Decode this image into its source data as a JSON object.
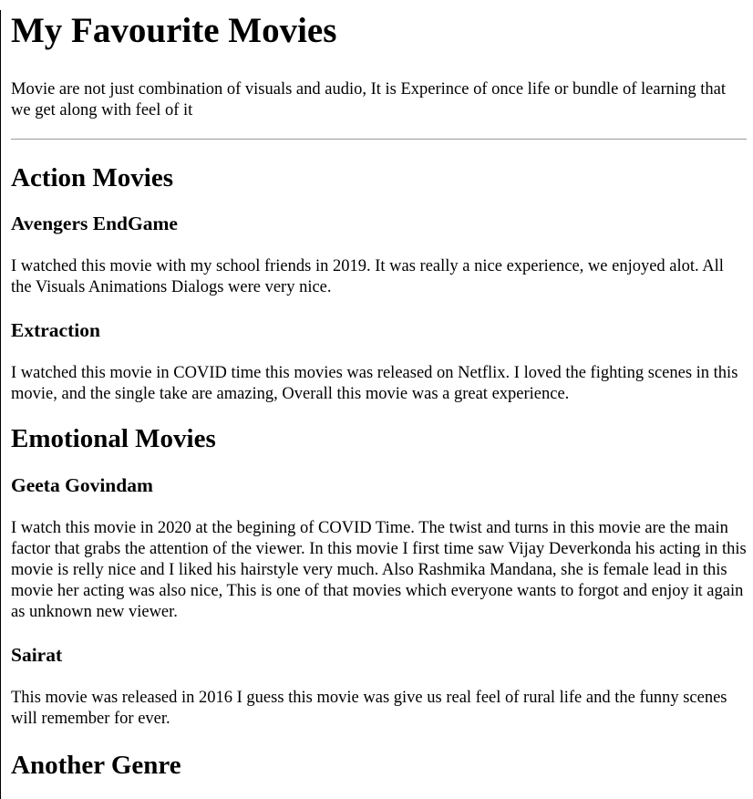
{
  "page": {
    "title": "My Favourite Movies",
    "intro": "Movie are not just combination of visuals and audio, It is Experince of once life or bundle of learning that we get along with feel of it"
  },
  "sections": [
    {
      "heading": "Action Movies",
      "movies": [
        {
          "title": "Avengers EndGame",
          "text": "I watched this movie with my school friends in 2019. It was really a nice experience, we enjoyed alot. All the Visuals Animations Dialogs were very nice."
        },
        {
          "title": "Extraction",
          "text": "I watched this movie in COVID time this movies was released on Netflix. I loved the fighting scenes in this movie, and the single take are amazing, Overall this movie was a great experience."
        }
      ]
    },
    {
      "heading": "Emotional Movies",
      "movies": [
        {
          "title": "Geeta Govindam",
          "text": "I watch this movie in 2020 at the begining of COVID Time. The twist and turns in this movie are the main factor that grabs the attention of the viewer. In this movie I first time saw Vijay Deverkonda his acting in this movie is relly nice and I liked his hairstyle very much. Also Rashmika Mandana, she is female lead in this movie her acting was also nice, This is one of that movies which everyone wants to forgot and enjoy it again as unknown new viewer."
        },
        {
          "title": "Sairat",
          "text": "This movie was released in 2016 I guess this movie was give us real feel of rural life and the funny scenes will remember for ever."
        }
      ]
    },
    {
      "heading": "Another Genre"
    }
  ]
}
